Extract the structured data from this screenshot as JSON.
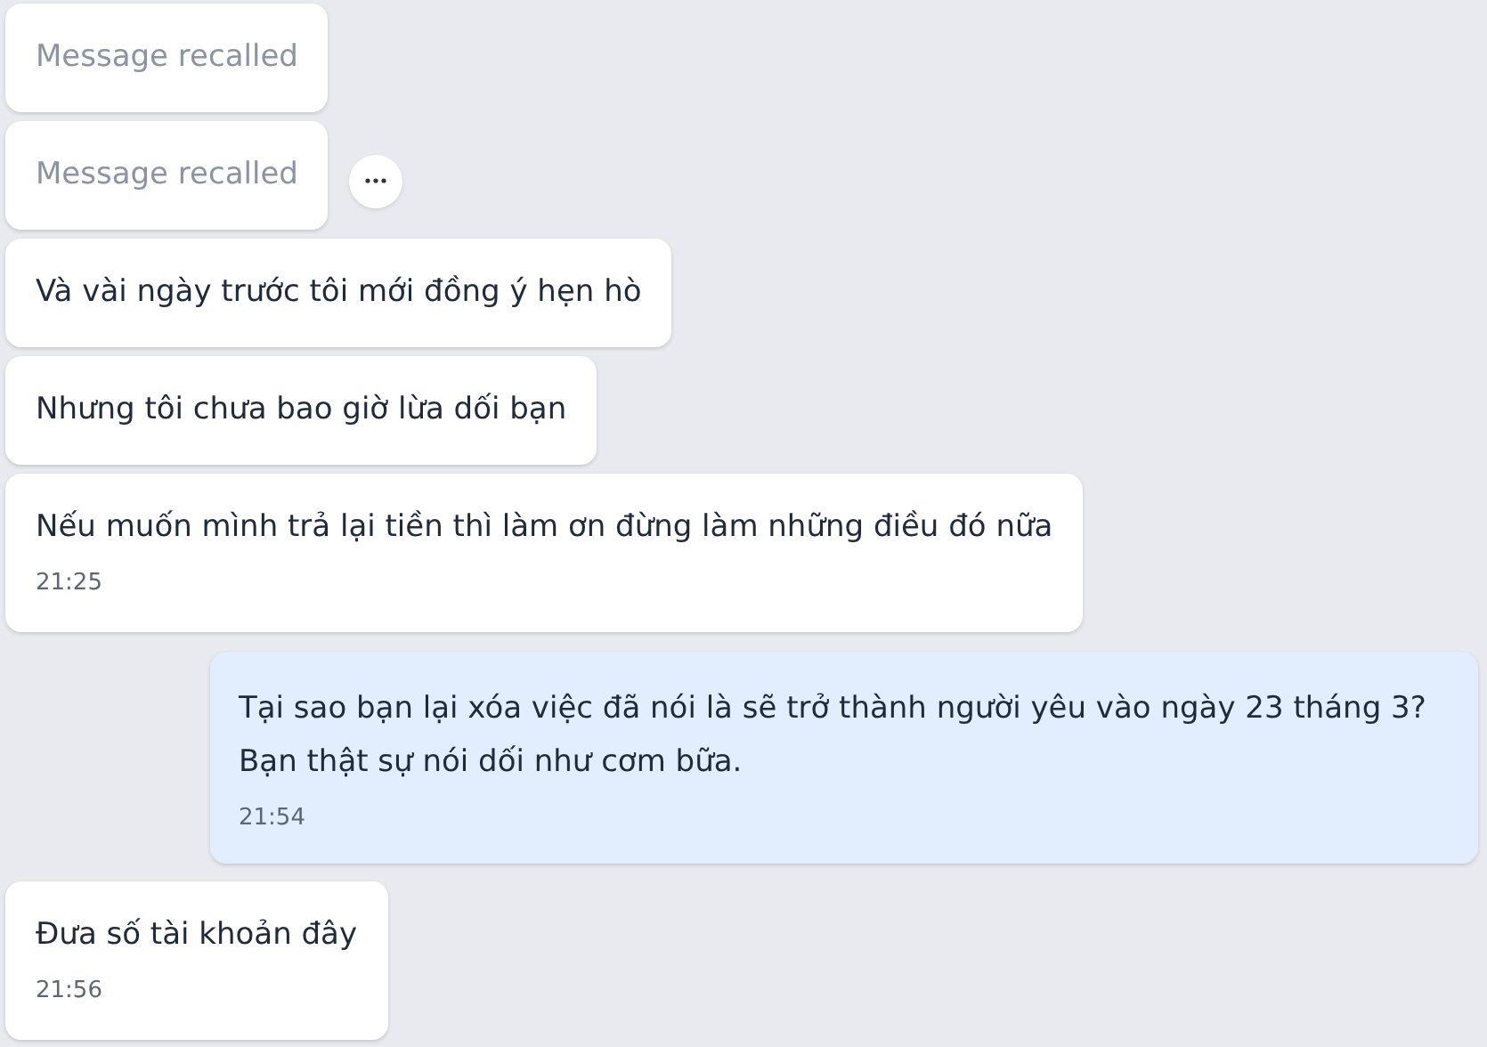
{
  "messages": [
    {
      "kind": "recalled",
      "text": "Message recalled",
      "has_menu": false
    },
    {
      "kind": "recalled",
      "text": "Message recalled",
      "has_menu": true
    },
    {
      "kind": "incoming",
      "text": "Và vài ngày trước tôi mới đồng ý hẹn hò",
      "has_menu": false
    },
    {
      "kind": "incoming",
      "text": "Nhưng tôi chưa bao giờ lừa dối bạn",
      "has_menu": false
    },
    {
      "kind": "incoming",
      "text": "Nếu muốn mình trả lại tiền thì làm ơn đừng làm những điều đó nữa",
      "time": "21:25",
      "has_menu": false
    },
    {
      "kind": "outgoing",
      "text": "Tại sao bạn lại xóa việc đã nói là sẽ trở thành người yêu vào ngày 23 tháng 3? Bạn thật sự nói dối như cơm bữa.",
      "time": "21:54",
      "has_menu": false
    },
    {
      "kind": "incoming",
      "text": "Đưa số tài khoản đây",
      "time": "21:56",
      "has_menu": false
    }
  ]
}
